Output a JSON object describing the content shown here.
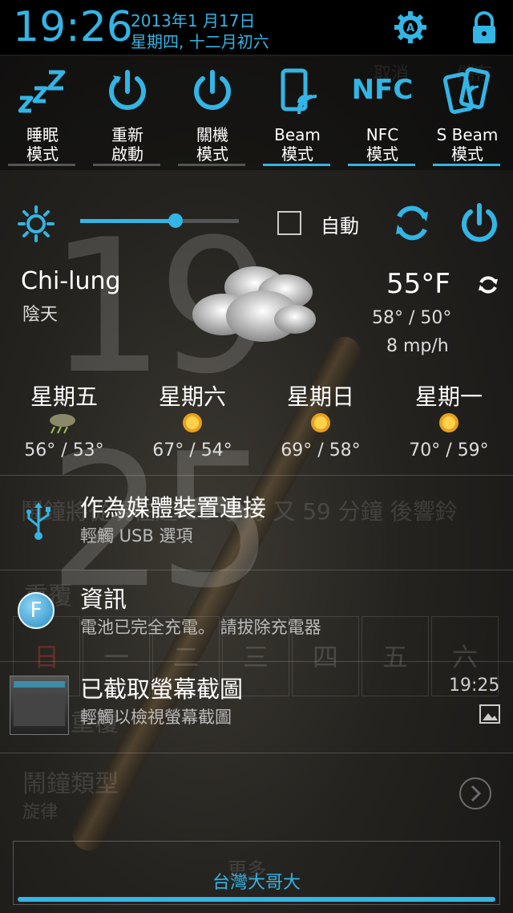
{
  "status": {
    "time": "19:26",
    "date_line1": "2013年1 月17日",
    "date_line2": "星期四, 十二月初六"
  },
  "toggles": [
    {
      "line1": "睡眠",
      "line2": "模式",
      "icon": "sleep-zzz-icon",
      "active": false
    },
    {
      "line1": "重新",
      "line2": "啟動",
      "icon": "restart-icon",
      "active": false
    },
    {
      "line1": "關機",
      "line2": "模式",
      "icon": "power-icon",
      "active": false
    },
    {
      "line1": "Beam",
      "line2": "模式",
      "icon": "beam-icon",
      "active": true
    },
    {
      "line1": "NFC",
      "line2": "模式",
      "icon": "nfc-icon",
      "active": true
    },
    {
      "line1": "S Beam",
      "line2": "模式",
      "icon": "s-beam-icon",
      "active": true
    }
  ],
  "nfc_icon_text": "NFC",
  "brightness": {
    "level": 0.6,
    "auto_label": "自動"
  },
  "background": {
    "clock": "19 25",
    "cancel": "取消",
    "save": "儲存",
    "alarm_text": "鬧鐘將從現在起 23 小時 又 59 分鐘 後響鈴",
    "repeat": "重覆",
    "days": [
      "日",
      "一",
      "二",
      "三",
      "四",
      "五",
      "六"
    ],
    "weekly_repeat": "每週重覆",
    "alarm_type": "鬧鐘類型",
    "alarm_type_value": "旋律",
    "more": "更多"
  },
  "weather": {
    "city": "Chi-lung",
    "condition": "陰天",
    "temp": "55°F",
    "hilo": "58° / 50°",
    "wind": "8 mp/h",
    "forecast": [
      {
        "day": "星期五",
        "temps": "56° / 53°",
        "icon": "rain-icon"
      },
      {
        "day": "星期六",
        "temps": "67° / 54°",
        "icon": "sun-icon"
      },
      {
        "day": "星期日",
        "temps": "69° / 58°",
        "icon": "sun-icon"
      },
      {
        "day": "星期一",
        "temps": "70° / 59°",
        "icon": "sun-icon"
      }
    ]
  },
  "notifications": [
    {
      "title": "作為媒體裝置連接",
      "subtitle": "輕觸 USB 選項",
      "icon": "usb-icon"
    },
    {
      "title": "資訊",
      "subtitle": "電池已完全充電。 請拔除充電器",
      "icon": "f-badge-icon",
      "badge_letter": "F"
    },
    {
      "title": "已截取螢幕截圖",
      "subtitle": "輕觸以檢視螢幕截圖",
      "time": "19:25",
      "icon": "screenshot-thumbnail"
    }
  ],
  "carrier": "台灣大哥大",
  "colors": {
    "accent": "#33b5e5"
  }
}
